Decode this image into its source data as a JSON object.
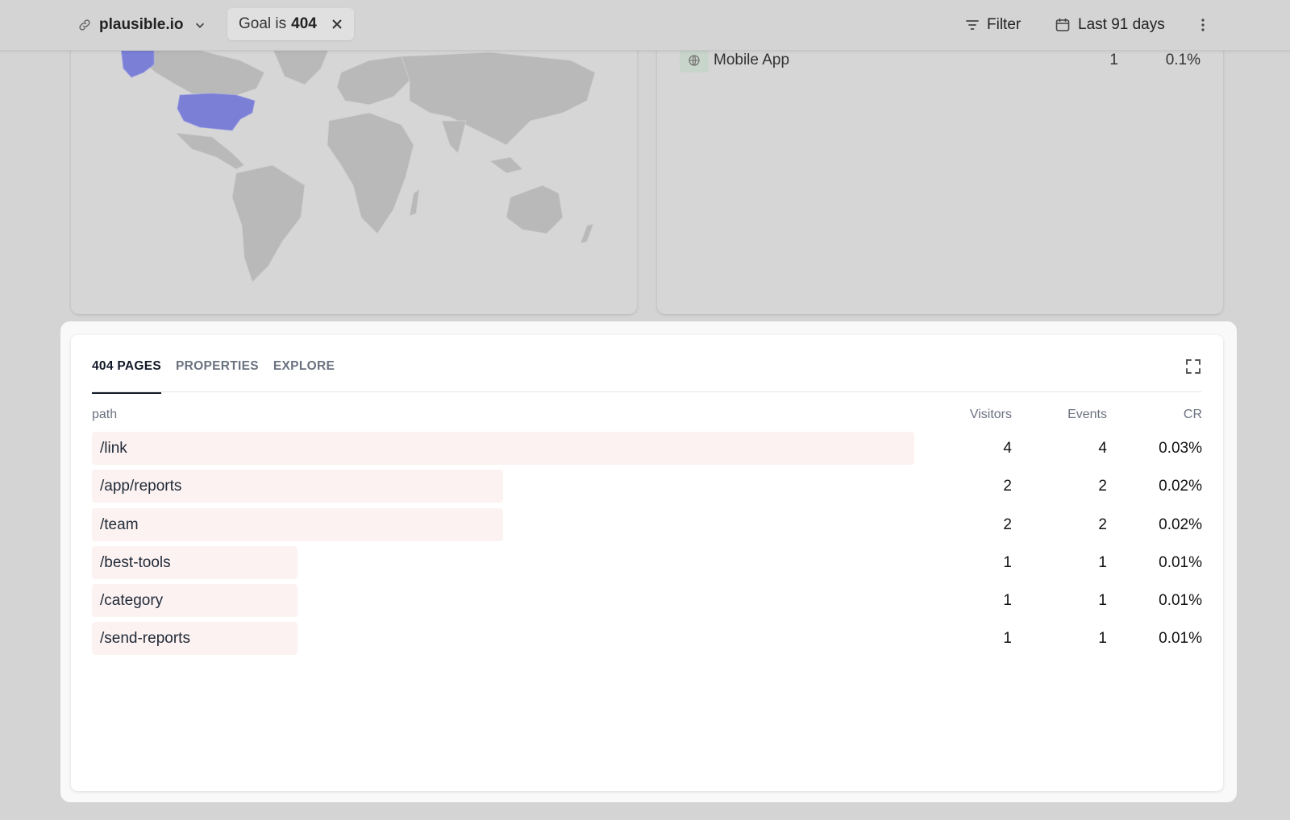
{
  "header": {
    "site_name": "plausible.io",
    "goal_prefix": "Goal is",
    "goal_value": "404",
    "filter_label": "Filter",
    "date_label": "Last 91 days"
  },
  "devices": {
    "row_label": "Mobile App",
    "row_value": "1",
    "row_pct": "0.1%"
  },
  "panel": {
    "tabs": [
      "404 PAGES",
      "PROPERTIES",
      "EXPLORE"
    ],
    "active_tab": "404 PAGES",
    "columns": {
      "path": "path",
      "visitors": "Visitors",
      "events": "Events",
      "cr": "CR"
    },
    "rows": [
      {
        "path": "/link",
        "visitors": "4",
        "events": "4",
        "cr": "0.03%",
        "share": 1.0
      },
      {
        "path": "/app/reports",
        "visitors": "2",
        "events": "2",
        "cr": "0.02%",
        "share": 0.5
      },
      {
        "path": "/team",
        "visitors": "2",
        "events": "2",
        "cr": "0.02%",
        "share": 0.5
      },
      {
        "path": "/best-tools",
        "visitors": "1",
        "events": "1",
        "cr": "0.01%",
        "share": 0.25
      },
      {
        "path": "/category",
        "visitors": "1",
        "events": "1",
        "cr": "0.01%",
        "share": 0.25
      },
      {
        "path": "/send-reports",
        "visitors": "1",
        "events": "1",
        "cr": "0.01%",
        "share": 0.25
      }
    ]
  },
  "colors": {
    "bar": "#fcf2f1",
    "map_highlight": "#7b7fd6"
  }
}
